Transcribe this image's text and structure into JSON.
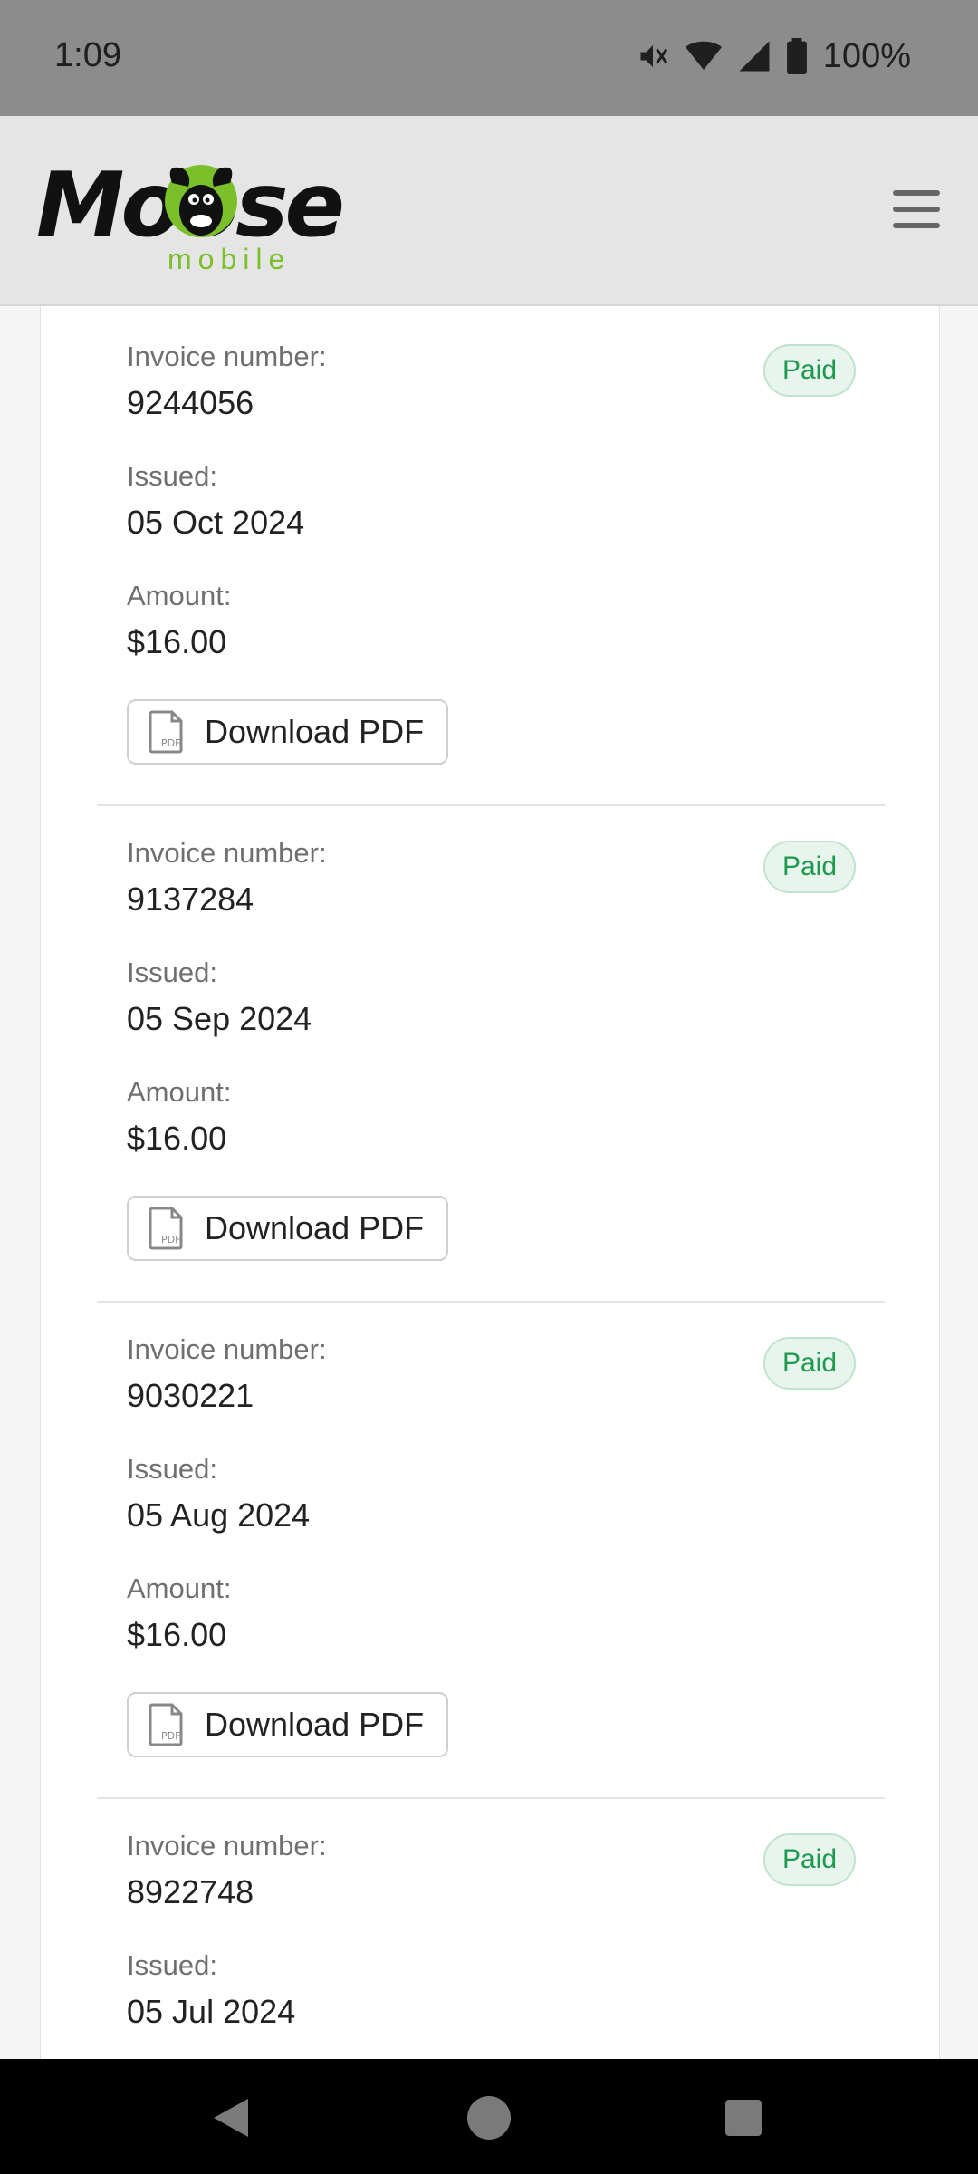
{
  "status_bar": {
    "time": "1:09",
    "battery": "100%",
    "icons": [
      "mute-icon",
      "wifi-icon",
      "signal-icon",
      "battery-icon"
    ]
  },
  "header": {
    "logo_word": "Moose",
    "logo_sub": "mobile",
    "menu_icon": "hamburger-icon"
  },
  "colors": {
    "paid_text": "#1f9850",
    "paid_bg": "#e8f5ec",
    "logo_green": "#7bbf2a"
  },
  "labels": {
    "invoice_number": "Invoice number:",
    "issued": "Issued:",
    "amount": "Amount:",
    "download": "Download PDF",
    "status": "Paid"
  },
  "invoices": [
    {
      "number": "9244056",
      "issued": "05 Oct 2024",
      "amount": "$16.00",
      "status": "Paid"
    },
    {
      "number": "9137284",
      "issued": "05 Sep 2024",
      "amount": "$16.00",
      "status": "Paid"
    },
    {
      "number": "9030221",
      "issued": "05 Aug 2024",
      "amount": "$16.00",
      "status": "Paid"
    },
    {
      "number": "8922748",
      "issued": "05 Jul 2024",
      "status": "Paid"
    }
  ]
}
